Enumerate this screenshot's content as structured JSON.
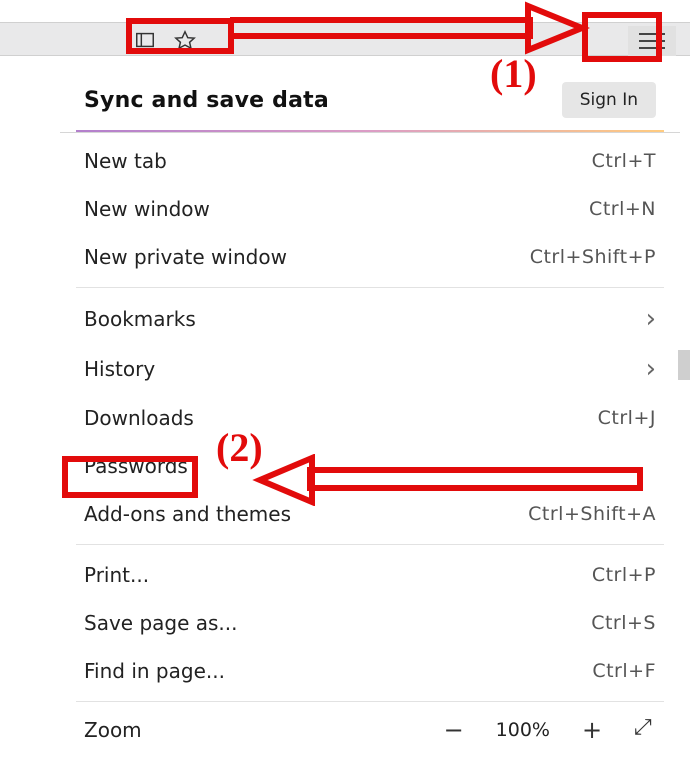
{
  "annotations": {
    "step1_label": "(1)",
    "step2_label": "(2)"
  },
  "menu": {
    "header_title": "Sync and save data",
    "signin_label": "Sign In",
    "items": [
      {
        "label": "New tab",
        "shortcut": "Ctrl+T"
      },
      {
        "label": "New window",
        "shortcut": "Ctrl+N"
      },
      {
        "label": "New private window",
        "shortcut": "Ctrl+Shift+P"
      }
    ],
    "items2": [
      {
        "label": "Bookmarks",
        "submenu": true
      },
      {
        "label": "History",
        "submenu": true
      },
      {
        "label": "Downloads",
        "shortcut": "Ctrl+J"
      },
      {
        "label": "Passwords"
      },
      {
        "label": "Add-ons and themes",
        "shortcut": "Ctrl+Shift+A"
      }
    ],
    "items3": [
      {
        "label": "Print...",
        "shortcut": "Ctrl+P"
      },
      {
        "label": "Save page as...",
        "shortcut": "Ctrl+S"
      },
      {
        "label": "Find in page...",
        "shortcut": "Ctrl+F"
      }
    ],
    "zoom": {
      "label": "Zoom",
      "value": "100%"
    }
  }
}
